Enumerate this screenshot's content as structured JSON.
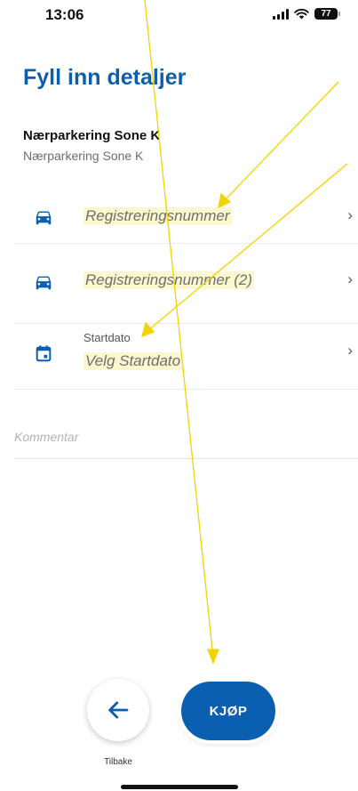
{
  "status_bar": {
    "time": "13:06",
    "battery": "77"
  },
  "header": {
    "title": "Fyll inn detaljer"
  },
  "zone": {
    "name": "Nærparkering Sone K",
    "subtitle": "Nærparkering Sone K"
  },
  "fields": [
    {
      "label": "",
      "placeholder": "Registreringsnummer",
      "icon": "car-icon"
    },
    {
      "label": "",
      "placeholder": "Registreringsnummer (2)",
      "icon": "car-icon"
    },
    {
      "label": "Startdato",
      "placeholder": "Velg Startdato",
      "icon": "calendar-icon"
    }
  ],
  "comment": {
    "placeholder": "Kommentar"
  },
  "footer": {
    "back_label": "Tilbake",
    "buy_label": "KJØP"
  },
  "colors": {
    "accent": "#0b5fb0",
    "highlight": "#fbf7cf",
    "annotation": "#f2d400"
  }
}
